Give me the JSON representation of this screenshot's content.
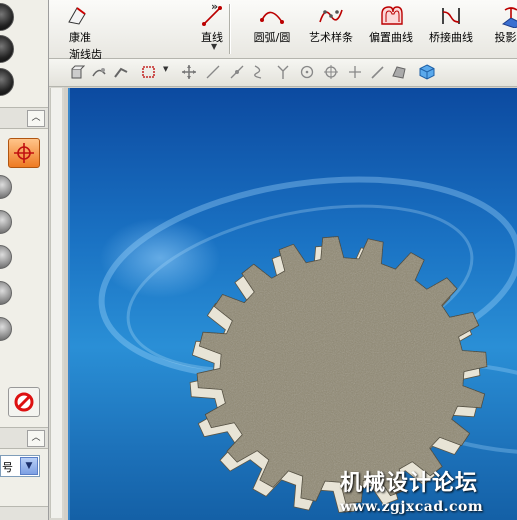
{
  "toolbar": {
    "more_chevrons": "»",
    "partial_tool_line1": "康准",
    "partial_tool_line2": "渐线齿",
    "dropdown_arrow": "▼",
    "tools": [
      {
        "name": "line",
        "label": "直线"
      },
      {
        "name": "arc-circle",
        "label": "圆弧/圆"
      },
      {
        "name": "studio-spline",
        "label": "艺术样条"
      },
      {
        "name": "offset-curve",
        "label": "偏置曲线"
      },
      {
        "name": "bridge-curve",
        "label": "桥接曲线"
      },
      {
        "name": "project-curve",
        "label": "投影曲"
      }
    ]
  },
  "left_panel": {
    "collapse_glyph": "︿",
    "combo_value": "号",
    "combo_arrow": "▼"
  },
  "viewport": {
    "watermark_title": "机械设计论坛",
    "watermark_url": "www.zgjxcad.com",
    "gear_teeth": 20,
    "colors": {
      "background_top": "#0c4aa0",
      "background_mid": "#2a8fd6",
      "gear_face": "#8f8872",
      "gear_side": "#e8e4d6"
    }
  }
}
